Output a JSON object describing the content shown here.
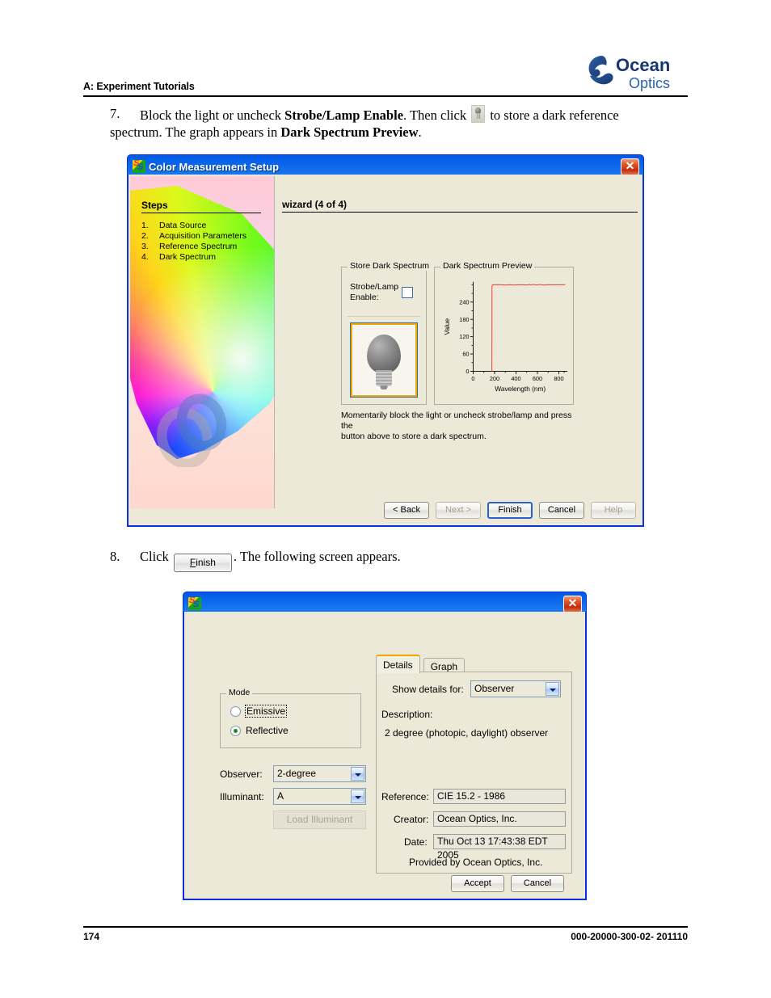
{
  "header": {
    "title": "A: Experiment Tutorials",
    "logo_top": "Ocean",
    "logo_bottom": "Optics"
  },
  "footer": {
    "page_number": "174",
    "doc_code": "000-20000-300-02- 201110"
  },
  "steps_text": {
    "step7": {
      "number": "7.",
      "part1": "Block the light or uncheck ",
      "bold1": "Strobe/Lamp Enable",
      "part2": ". Then click ",
      "part3": " to store a dark reference spectrum. The graph appears in ",
      "bold2": "Dark Spectrum Preview",
      "part4": "."
    },
    "step8": {
      "number": "8.",
      "part1": "Click ",
      "button_label_pre": "F",
      "button_label_post": "inish",
      "part2": ". The following screen appears."
    }
  },
  "wizard": {
    "title": "Color Measurement Setup",
    "close_label": "✕",
    "steps_heading": "Steps",
    "steps": [
      {
        "num": "1.",
        "label": "Data Source"
      },
      {
        "num": "2.",
        "label": "Acquisition Parameters"
      },
      {
        "num": "3.",
        "label": "Reference Spectrum"
      },
      {
        "num": "4.",
        "label": "Dark Spectrum"
      }
    ],
    "wizard_label": "wizard (4 of 4)",
    "store_group_title": "Store Dark Spectrum",
    "strobe_label_line1": "Strobe/Lamp",
    "strobe_label_line2": "Enable:",
    "strobe_checked": false,
    "bulb_button_name": "store-dark-spectrum-button",
    "preview_group_title": "Dark Spectrum Preview",
    "hint_line1": "Momentarily block the light or uncheck strobe/lamp and press the",
    "hint_line2": "button above to store a dark spectrum.",
    "buttons": {
      "back_pre": "< B",
      "back_mid": "a",
      "back_post": "ck",
      "back": "< Back",
      "next": "Next >",
      "finish_pre": "F",
      "finish_post": "inish",
      "finish": "Finish",
      "cancel": "Cancel",
      "help_pre": "H",
      "help_post": "elp",
      "help": "Help"
    }
  },
  "chart_data": {
    "type": "line",
    "title": "Dark Spectrum Preview",
    "xlabel": "Wavelength (nm)",
    "ylabel": "Value",
    "xlim": [
      0,
      880
    ],
    "ylim": [
      0,
      310
    ],
    "xticks": [
      0,
      200,
      400,
      600,
      800
    ],
    "xtick_labels": [
      "0",
      "200",
      "400",
      "600",
      "800"
    ],
    "yticks": [
      0,
      60,
      120,
      180,
      240
    ],
    "ytick_labels": [
      "0",
      "60",
      "120",
      "180",
      "240"
    ],
    "grid": false,
    "legend": "none",
    "series": [
      {
        "name": "dark spectrum",
        "color": "#ef3b3b",
        "x": [
          175,
          176,
          180,
          190,
          200,
          230,
          260,
          300,
          340,
          380,
          420,
          460,
          500,
          520,
          540,
          560,
          580,
          600,
          620,
          640,
          660,
          700,
          740,
          780,
          820,
          860
        ],
        "y": [
          0,
          296,
          299,
          300,
          300,
          300,
          300,
          299,
          300,
          299,
          300,
          300,
          299,
          301,
          299,
          301,
          300,
          299,
          301,
          300,
          299,
          300,
          300,
          300,
          300,
          300
        ]
      }
    ]
  },
  "details_dialog": {
    "title": "",
    "close_label": "✕",
    "mode_group_title": "Mode",
    "mode_options": [
      {
        "label": "Emissive",
        "checked": false
      },
      {
        "label": "Reflective",
        "checked": true
      }
    ],
    "observer_label": "Observer:",
    "observer_value": "2-degree",
    "illuminant_label": "Illuminant:",
    "illuminant_value": "A",
    "load_illuminant_label": "Load Illuminant",
    "tabs": [
      {
        "label": "Details",
        "active": true
      },
      {
        "label": "Graph",
        "active": false
      }
    ],
    "show_details_label": "Show details for:",
    "show_details_value": "Observer",
    "description_label": "Description:",
    "description_value": "2 degree (photopic, daylight) observer",
    "reference_label": "Reference:",
    "reference_value": "CIE 15.2 - 1986",
    "creator_label": "Creator:",
    "creator_value": "Ocean Optics, Inc.",
    "date_label": "Date:",
    "date_value": "Thu Oct 13 17:43:38 EDT 2005",
    "provided_by": "Provided by Ocean Optics, Inc.",
    "accept_label": "Accept",
    "cancel_label": "Cancel"
  }
}
